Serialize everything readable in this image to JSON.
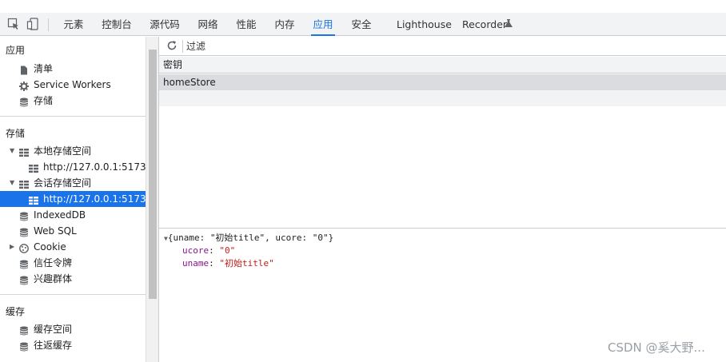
{
  "toolbar": {
    "tabs": [
      {
        "label": "元素",
        "active": false
      },
      {
        "label": "控制台",
        "active": false
      },
      {
        "label": "源代码",
        "active": false
      },
      {
        "label": "网络",
        "active": false
      },
      {
        "label": "性能",
        "active": false
      },
      {
        "label": "内存",
        "active": false
      },
      {
        "label": "应用",
        "active": true
      },
      {
        "label": "安全",
        "active": false
      },
      {
        "label": "Lighthouse",
        "active": false
      },
      {
        "label": "Recorder",
        "active": false
      }
    ],
    "icons": [
      "inspect-element-icon",
      "device-toolbar-icon",
      "flask-icon"
    ]
  },
  "sidebar": {
    "application": {
      "title": "应用",
      "items": [
        {
          "label": "清单",
          "icon": "file-icon"
        },
        {
          "label": "Service Workers",
          "icon": "gear-icon"
        },
        {
          "label": "存储",
          "icon": "database-icon"
        }
      ]
    },
    "storage": {
      "title": "存储",
      "local_storage": {
        "label": "本地存储空间",
        "children": [
          "http://127.0.0.1:5173/"
        ]
      },
      "session_storage": {
        "label": "会话存储空间",
        "children": [
          "http://127.0.0.1:5173/"
        ]
      },
      "items": [
        {
          "label": "IndexedDB",
          "icon": "database-icon"
        },
        {
          "label": "Web SQL",
          "icon": "database-icon"
        },
        {
          "label": "Cookie",
          "icon": "cookie-icon"
        },
        {
          "label": "信任令牌",
          "icon": "database-icon"
        },
        {
          "label": "兴趣群体",
          "icon": "database-icon"
        }
      ]
    },
    "cache": {
      "title": "缓存",
      "items": [
        {
          "label": "缓存空间",
          "icon": "database-icon"
        },
        {
          "label": "往返缓存",
          "icon": "database-icon"
        }
      ]
    }
  },
  "main": {
    "filter_placeholder": "过滤",
    "table": {
      "header": "密钥",
      "rows": [
        "homeStore"
      ]
    },
    "preview": {
      "summary_open": "{uname: ",
      "summary_uname": "\"初始title\"",
      "summary_mid": ", ucore: ",
      "summary_ucore": "\"0\"",
      "summary_close": "}",
      "props": [
        {
          "key": "ucore",
          "value": "\"0\""
        },
        {
          "key": "uname",
          "value": "\"初始title\""
        }
      ]
    }
  },
  "watermark": "CSDN @奚大野..."
}
